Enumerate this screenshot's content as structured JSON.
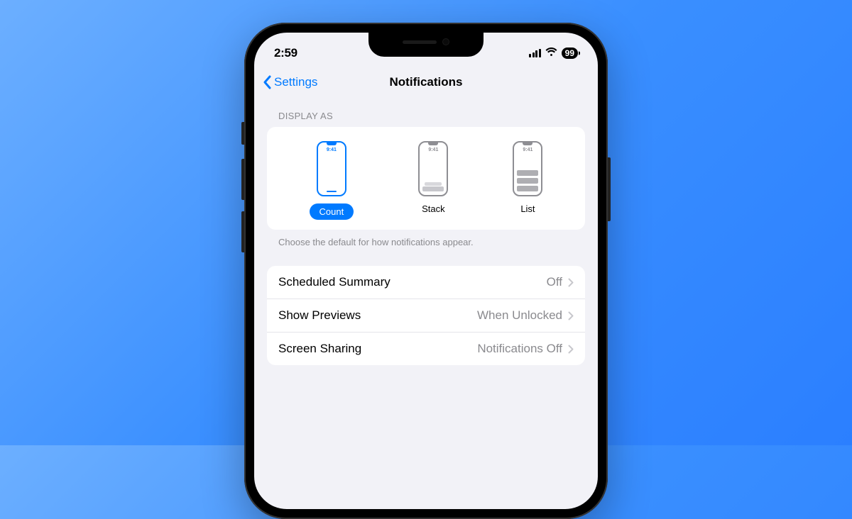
{
  "status_bar": {
    "time": "2:59",
    "battery": "99"
  },
  "nav": {
    "back_label": "Settings",
    "title": "Notifications"
  },
  "display_as": {
    "header": "Display As",
    "options": [
      {
        "label": "Count",
        "preview_time": "9:41",
        "selected": true
      },
      {
        "label": "Stack",
        "preview_time": "9:41",
        "selected": false
      },
      {
        "label": "List",
        "preview_time": "9:41",
        "selected": false
      }
    ],
    "footer": "Choose the default for how notifications appear."
  },
  "rows": [
    {
      "label": "Scheduled Summary",
      "value": "Off"
    },
    {
      "label": "Show Previews",
      "value": "When Unlocked"
    },
    {
      "label": "Screen Sharing",
      "value": "Notifications Off"
    }
  ]
}
